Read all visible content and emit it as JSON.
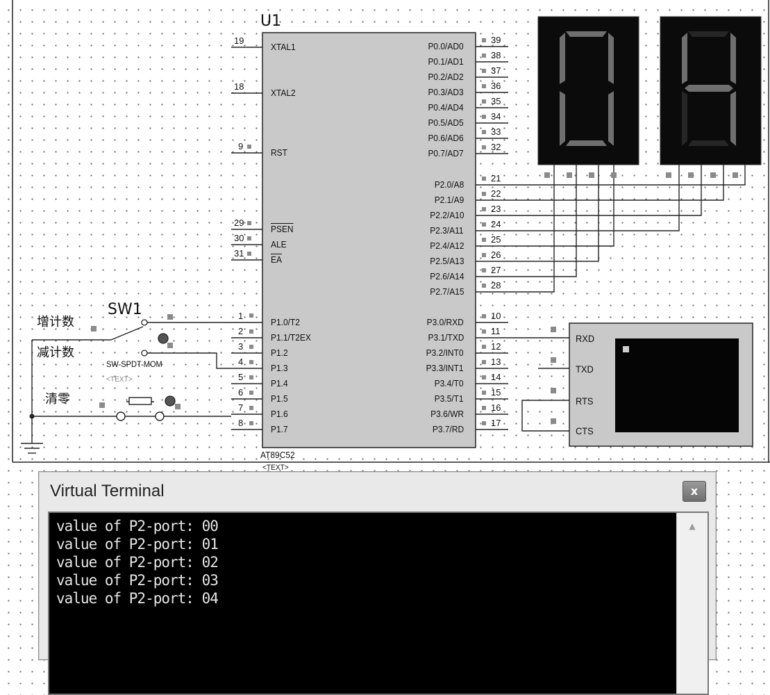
{
  "schematic": {
    "mcu": {
      "ref": "U1",
      "part": "AT89C52",
      "text_placeholder": "<TEXT>",
      "left_pins": [
        {
          "num": "19",
          "name": "XTAL1"
        },
        {
          "num": "18",
          "name": "XTAL2"
        },
        {
          "num": "9",
          "name": "RST"
        },
        {
          "num": "29",
          "name": "PSEN"
        },
        {
          "num": "30",
          "name": "ALE"
        },
        {
          "num": "31",
          "name": "EA"
        },
        {
          "num": "1",
          "name": "P1.0/T2"
        },
        {
          "num": "2",
          "name": "P1.1/T2EX"
        },
        {
          "num": "3",
          "name": "P1.2"
        },
        {
          "num": "4",
          "name": "P1.3"
        },
        {
          "num": "5",
          "name": "P1.4"
        },
        {
          "num": "6",
          "name": "P1.5"
        },
        {
          "num": "7",
          "name": "P1.6"
        },
        {
          "num": "8",
          "name": "P1.7"
        }
      ],
      "right_pins": [
        {
          "num": "39",
          "name": "P0.0/AD0"
        },
        {
          "num": "38",
          "name": "P0.1/AD1"
        },
        {
          "num": "37",
          "name": "P0.2/AD2"
        },
        {
          "num": "36",
          "name": "P0.3/AD3"
        },
        {
          "num": "35",
          "name": "P0.4/AD4"
        },
        {
          "num": "34",
          "name": "P0.5/AD5"
        },
        {
          "num": "33",
          "name": "P0.6/AD6"
        },
        {
          "num": "32",
          "name": "P0.7/AD7"
        },
        {
          "num": "21",
          "name": "P2.0/A8"
        },
        {
          "num": "22",
          "name": "P2.1/A9"
        },
        {
          "num": "23",
          "name": "P2.2/A10"
        },
        {
          "num": "24",
          "name": "P2.3/A11"
        },
        {
          "num": "25",
          "name": "P2.4/A12"
        },
        {
          "num": "26",
          "name": "P2.5/A13"
        },
        {
          "num": "27",
          "name": "P2.6/A14"
        },
        {
          "num": "28",
          "name": "P2.7/A15"
        },
        {
          "num": "10",
          "name": "P3.0/RXD"
        },
        {
          "num": "11",
          "name": "P3.1/TXD"
        },
        {
          "num": "12",
          "name": "P3.2/INT0"
        },
        {
          "num": "13",
          "name": "P3.3/INT1"
        },
        {
          "num": "14",
          "name": "P3.4/T0"
        },
        {
          "num": "15",
          "name": "P3.5/T1"
        },
        {
          "num": "16",
          "name": "P3.6/WR"
        },
        {
          "num": "17",
          "name": "P3.7/RD"
        }
      ]
    },
    "switch": {
      "ref": "SW1",
      "part": "SW-SPDT-MOM",
      "text_placeholder": "<TEXT>",
      "label_increment": "增计数",
      "label_decrement": "减计数"
    },
    "reset_button_label": "清零",
    "seven_segment": {
      "digit_left": "0",
      "digit_right": "4",
      "color": "#6f6f6f",
      "background": "#0b0b0b"
    },
    "terminal_component": {
      "pins": [
        "RXD",
        "TXD",
        "RTS",
        "CTS"
      ]
    }
  },
  "virtual_terminal": {
    "title": "Virtual Terminal",
    "close_label": "x",
    "lines": [
      "value of P2-port: 00",
      "value of P2-port: 01",
      "value of P2-port: 02",
      "value of P2-port: 03",
      "value of P2-port: 04"
    ]
  }
}
